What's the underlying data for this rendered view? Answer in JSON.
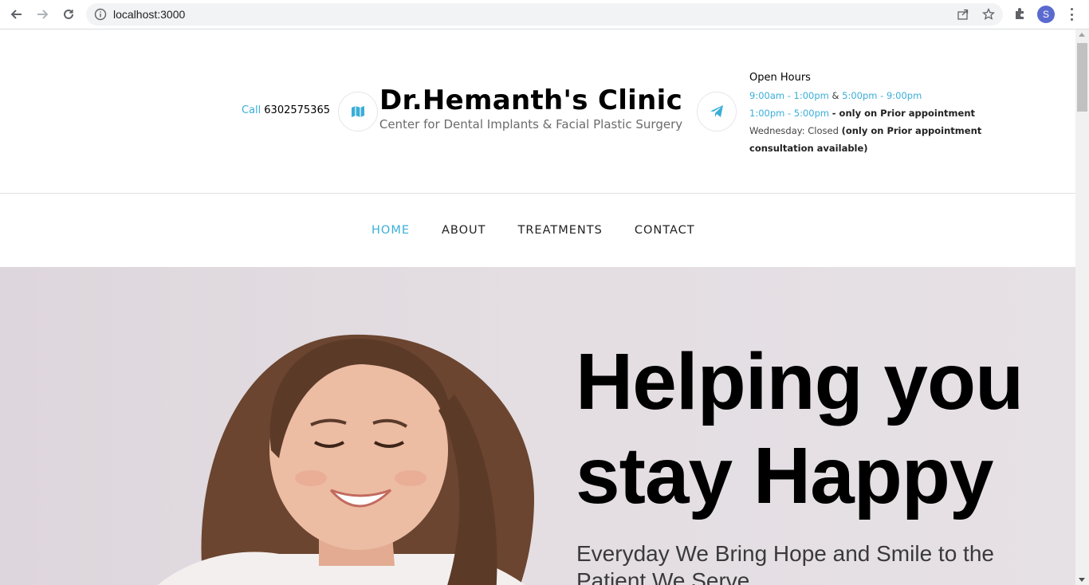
{
  "browser": {
    "url": "localhost:3000",
    "profile_initial": "S",
    "icons": [
      "back-icon",
      "forward-icon",
      "reload-icon",
      "info-icon",
      "share-icon",
      "star-icon",
      "extensions-icon",
      "menu-icon"
    ]
  },
  "header": {
    "call_label": "Call",
    "phone": "6302575365",
    "clinic_name": "Dr.Hemanth's Clinic",
    "tagline": "Center for Dental Implants & Facial Plastic Surgery",
    "left_icon": "map-icon",
    "right_icon": "paper-plane-icon",
    "hours": {
      "title": "Open Hours",
      "slot1": "9:00am - 1:00pm",
      "amp": "&",
      "slot2": "5:00pm - 9:00pm",
      "slot3": "1:00pm - 5:00pm",
      "slot3_note": "- only on Prior appointment",
      "wed": "Wednesday: Closed",
      "wed_note": "(only on Prior appointment consultation available)"
    }
  },
  "nav": {
    "items": [
      {
        "label": "HOME",
        "active": true
      },
      {
        "label": "ABOUT",
        "active": false
      },
      {
        "label": "TREATMENTS",
        "active": false
      },
      {
        "label": "CONTACT",
        "active": false
      }
    ]
  },
  "hero": {
    "heading_line1": "Helping you",
    "heading_line2": "stay Happy",
    "subtitle": "Everyday We Bring Hope and Smile to the Patient We Serve"
  },
  "colors": {
    "accent": "#3aaed8",
    "hero_bg": "#e3dde2",
    "hair": "#6b4530",
    "skin": "#e9b9a0"
  }
}
